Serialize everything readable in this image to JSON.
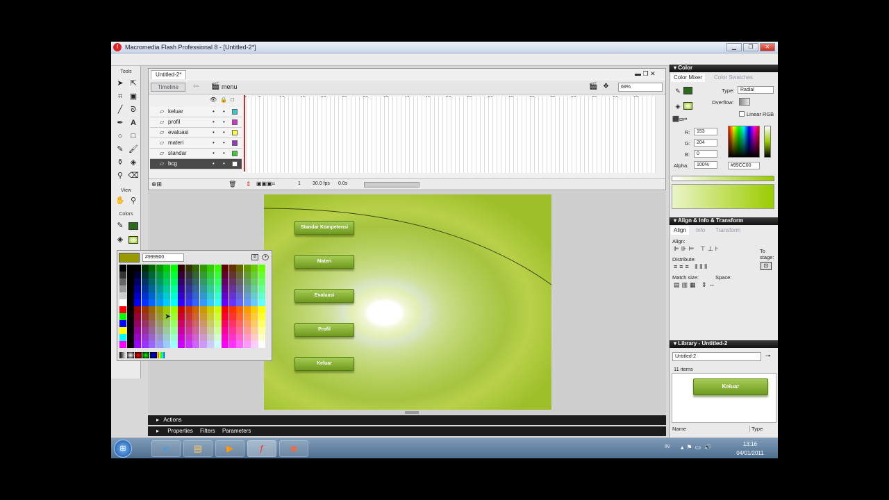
{
  "window": {
    "title": "Macromedia Flash Professional 8 - [Untitled-2*]",
    "min": "▁",
    "max": "❐",
    "close": "✕"
  },
  "tools": {
    "heading": "Tools",
    "view_label": "View",
    "colors_label": "Colors"
  },
  "document": {
    "tab": "Untitled-2*",
    "timeline_button": "Timeline",
    "scene": "menu",
    "zoom": "69%"
  },
  "timeline": {
    "layers": [
      {
        "name": "keluar",
        "color": "#33cccc"
      },
      {
        "name": "profil",
        "color": "#cc33cc"
      },
      {
        "name": "evaluasi",
        "color": "#ffff33"
      },
      {
        "name": "materi",
        "color": "#9933cc"
      },
      {
        "name": "standar",
        "color": "#33cc33"
      },
      {
        "name": "bcg",
        "color": "#ffffff",
        "selected": true
      }
    ],
    "ruler": [
      "1",
      "5",
      "10",
      "15",
      "20",
      "25",
      "30",
      "35",
      "40",
      "45",
      "50",
      "55",
      "60",
      "65",
      "70",
      "75",
      "80",
      "85",
      "90",
      "95"
    ],
    "frame": "1",
    "fps": "30.0 fps",
    "time": "0.0s"
  },
  "stage": {
    "buttons": [
      "Standar Kompetensi",
      "Materi",
      "Evaluasi",
      "Profil",
      "Keluar"
    ]
  },
  "picker": {
    "hex": "#999900",
    "current_color": "#999900"
  },
  "bottom": {
    "actions": "Actions",
    "tabs": [
      "Properties",
      "Filters",
      "Parameters"
    ]
  },
  "color_panel": {
    "title": "Color",
    "tab_mixer": "Color Mixer",
    "tab_swatches": "Color Swatches",
    "type_label": "Type:",
    "type_value": "Radial",
    "overflow_label": "Overflow:",
    "linear_rgb": "Linear RGB",
    "r_label": "R:",
    "r": "153",
    "g_label": "G:",
    "g": "204",
    "b_label": "B:",
    "b": "0",
    "alpha_label": "Alpha:",
    "alpha": "100%",
    "hex": "#99CC00"
  },
  "align_panel": {
    "title": "Align & Info & Transform",
    "tabs": [
      "Align",
      "Info",
      "Transform"
    ],
    "align_label": "Align:",
    "distribute_label": "Distribute:",
    "match_label": "Match size:",
    "space_label": "Space:",
    "to_stage": "To stage:"
  },
  "library": {
    "title": "Library - Untitled-2",
    "doc": "Untitled-2",
    "items": "11 items",
    "preview": "Keluar",
    "col_name": "Name",
    "col_type": "Type"
  },
  "taskbar": {
    "lang": "IN",
    "time": "13:16",
    "date": "04/01/2011"
  }
}
